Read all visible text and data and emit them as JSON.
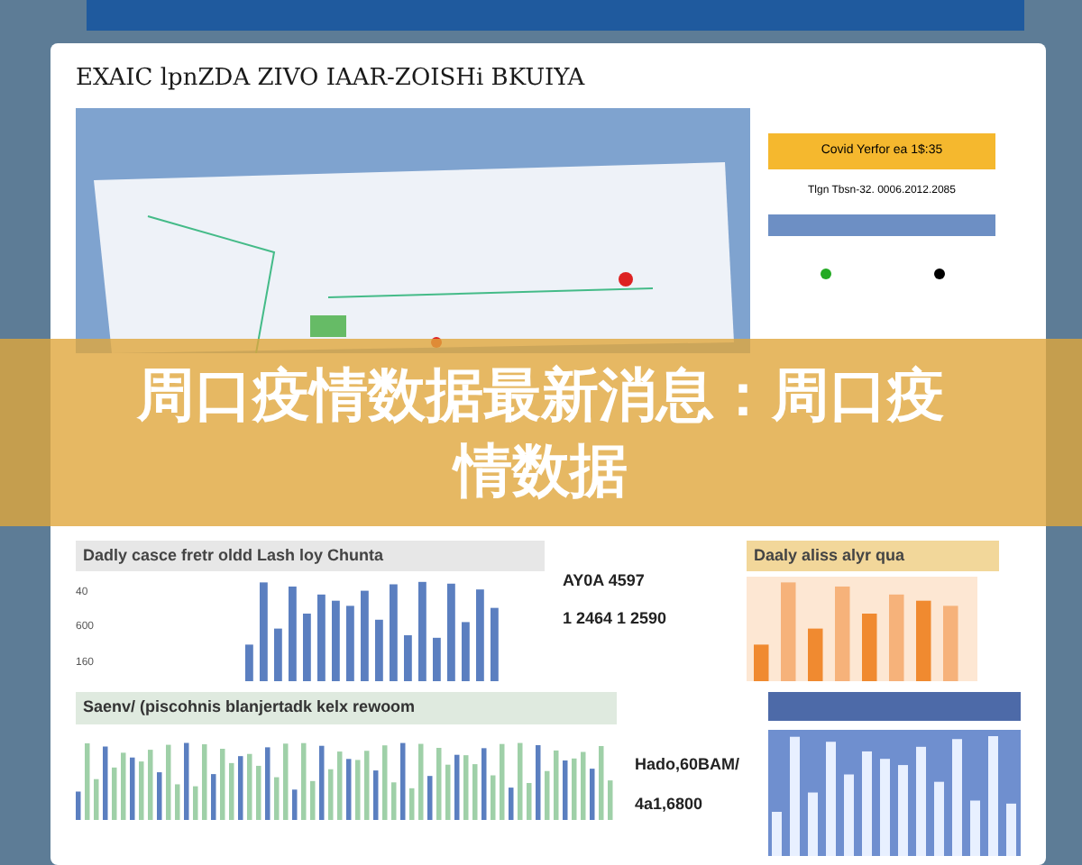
{
  "dashboard": {
    "title": "EXAIC lpnZDA ZIVO IAAR-ZOISHi BKUIYA"
  },
  "side_panel": {
    "header": "Covid Yerfor ea 1$:35",
    "subtitle": "Tlgn Tbsn-32. 0006.2012.2085"
  },
  "banner": {
    "text": "周口疫情数据最新消息：周口疫情数据"
  },
  "daily_cases": {
    "title": "Dadly casce fretr oldd Lash loy Chunta",
    "y_labels": [
      "40",
      "600",
      "160"
    ]
  },
  "daily_stats": {
    "title": "Daaly aliss alyr qua",
    "values": [
      "AY0A 4597",
      "1 2464 1 2590"
    ]
  },
  "weekly": {
    "title": "Saenv/ (piscohnis  blanjertadk kelx rewoom",
    "values": [
      "Hado,60BAM/",
      "4a1,6800"
    ]
  }
}
